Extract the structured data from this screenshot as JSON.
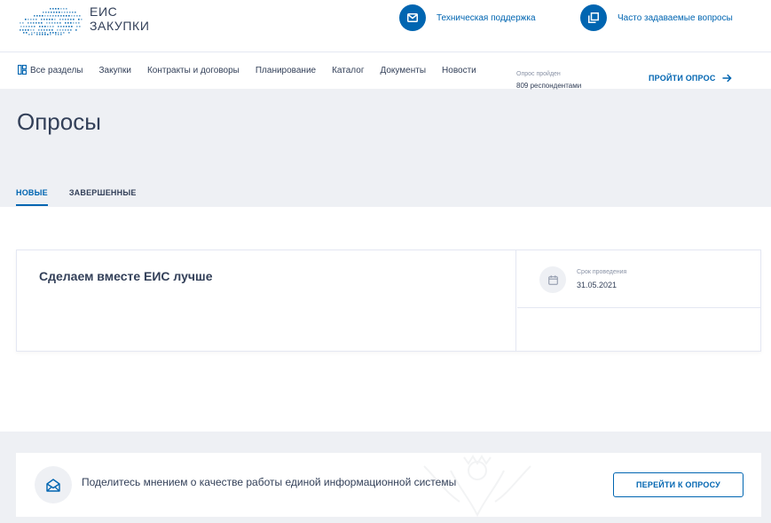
{
  "header": {
    "logo_line1": "ЕИС",
    "logo_line2": "ЗАКУПКИ",
    "support_label": "Техническая поддержка",
    "faq_label": "Часто задаваемые вопросы"
  },
  "nav": {
    "items": [
      "Все разделы",
      "Закупки",
      "Контракты и договоры",
      "Планирование",
      "Каталог",
      "Документы",
      "Новости"
    ]
  },
  "page": {
    "title": "Опросы",
    "tabs": [
      {
        "label": "НОВЫЕ",
        "active": true
      },
      {
        "label": "ЗАВЕРШЕННЫЕ",
        "active": false
      }
    ]
  },
  "survey_card": {
    "title": "Сделаем вместе ЕИС лучше",
    "deadline_label": "Срок проведения",
    "deadline_value": "31.05.2021",
    "passed_label": "Опрос пройден",
    "passed_value": "809 респондентами",
    "action_label": "ПРОЙТИ ОПРОС"
  },
  "feedback": {
    "text": "Поделитесь мнением о качестве работы единой информационной системы",
    "button_label": "ПЕРЕЙТИ К ОПРОСУ"
  },
  "icons": {
    "support": "envelope-icon",
    "faq": "windows-icon",
    "nav_all": "grid-icon",
    "deadline": "calendar-icon",
    "action": "arrow-right-icon",
    "feedback": "open-envelope-icon"
  },
  "colors": {
    "accent": "#0065b1",
    "text": "#334059",
    "muted": "#8a93a6",
    "panel": "#eef0f4"
  }
}
